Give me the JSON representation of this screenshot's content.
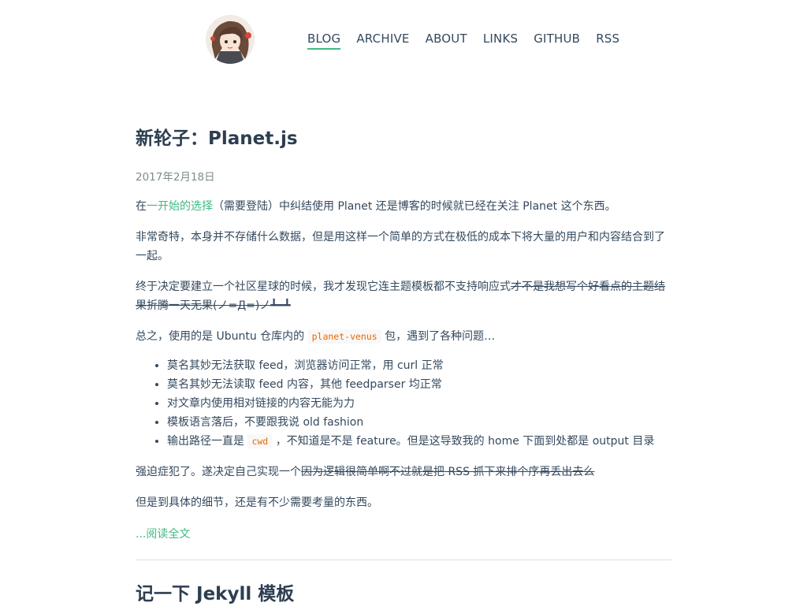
{
  "nav": {
    "items": [
      "BLOG",
      "ARCHIVE",
      "ABOUT",
      "LINKS",
      "GITHUB",
      "RSS"
    ],
    "active": "BLOG"
  },
  "avatar_icon": "anime-girl-avatar",
  "post": {
    "title": "新轮子：Planet.js",
    "date": "2017年2月18日",
    "p1": {
      "before": "在",
      "link": "一开始的选择",
      "after": "（需要登陆）中纠结使用 Planet 还是博客的时候就已经在关注 Planet 这个东西。"
    },
    "p2": "非常奇特，本身并不存储什么数据，但是用这样一个简单的方式在极低的成本下将大量的用户和内容结合到了一起。",
    "p3": {
      "text": "终于决定要建立一个社区星球的时候，我才发现它连主题模板都不支持响应式",
      "struck": "才不是我想写个好看点的主题结果折腾一天无果(ノ=Д=)ノ┻━┻"
    },
    "p4": {
      "before": "总之，使用的是 Ubuntu 仓库内的",
      "code": "planet-venus",
      "after": "包，遇到了各种问题…"
    },
    "issues": [
      {
        "text": "莫名其妙无法获取 feed，浏览器访问正常，用 curl 正常"
      },
      {
        "text": "莫名其妙无法读取 feed 内容，其他 feedparser 均正常"
      },
      {
        "text": "对文章内使用相对链接的内容无能为力"
      },
      {
        "text": "模板语言落后，不要跟我说 old fashion"
      },
      {
        "before": "输出路径一直是",
        "code": "cwd",
        "after": "，不知道是不是 feature。但是这导致我的 home 下面到处都是 output 目录"
      }
    ],
    "p5": {
      "text": "强迫症犯了。遂决定自己实现一个",
      "struck": "因为逻辑很简单啊不过就是把 RSS 抓下来排个序再丢出去么"
    },
    "p6": "但是到具体的细节，还是有不少需要考量的东西。",
    "read_more": "...阅读全文"
  },
  "next_post": {
    "title": "记一下 Jekyll 模板"
  }
}
